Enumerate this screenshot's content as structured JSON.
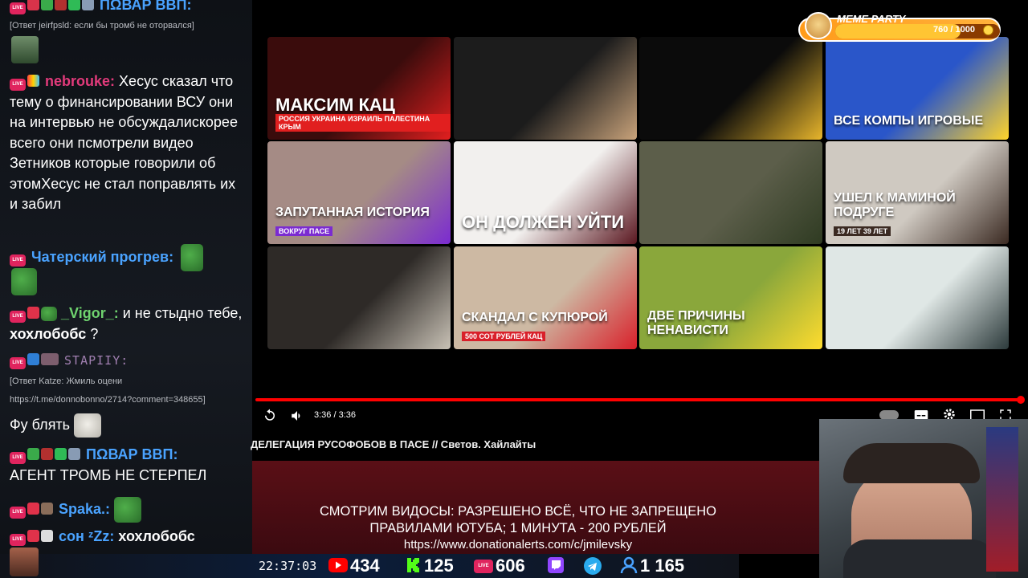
{
  "chat": {
    "top_name": "ΠΩВАР ВВΠ:",
    "messages": [
      {
        "reply": "[Ответ jeirfpsld: если бы тромб не оторвался]"
      },
      {
        "name": "nebrouke:",
        "text": "Хесус сказал что тему о финансировании ВСУ они на интервью не обсуждалискорее всего они псмотрели видео Зетников которые говорили об этомХесус не стал поправлять их и забил"
      },
      {
        "name": "Чатерский прогрев:",
        "text": ""
      },
      {
        "name": "_Vigor_:",
        "text": "и не стыдно тебе,",
        "bold_tail": "хохлобобс",
        "tail_suffix": " ?"
      },
      {
        "name": "STAPIIY:",
        "text": ""
      },
      {
        "reply": "[Ответ Katze: Жмиль оцени"
      },
      {
        "link": "https://t.me/donnobonno/2714?comment=348655]"
      },
      {
        "text": "Фу блять"
      },
      {
        "name": "ΠΩВАР ВВΠ:",
        "text": "АГЕНТ ТРОМБ НЕ СТЕРПЕЛ"
      },
      {
        "name": "Spaka.:",
        "text": ""
      },
      {
        "name": "сон ᶻZz:",
        "text": "хохлобобс"
      }
    ]
  },
  "thumbnails": [
    {
      "caption": "МАКСИМ КАЦ",
      "sub": "РОССИЯ УКРАИНА ИЗРАИЛЬ ПАЛЕСТИНА КРЫМ",
      "bg": "#3a0c0c",
      "accent": "#e11f1f"
    },
    {
      "caption": "",
      "sub": "",
      "bg": "#1c1c1c",
      "accent": "#c8a27a"
    },
    {
      "caption": "",
      "sub": "",
      "bg": "#0b0b0b",
      "accent": "#e7b52c"
    },
    {
      "caption": "ВСЕ КОМПЫ ИГРОВЫЕ",
      "sub": "",
      "bg": "#2a56c9",
      "accent": "#ffd42a"
    },
    {
      "caption": "ЗАПУТАННАЯ ИСТОРИЯ",
      "sub": "ВОКРУГ ПАСЕ",
      "bg": "#a58b85",
      "accent": "#7b2bd1"
    },
    {
      "caption": "ОН ДОЛЖЕН УЙТИ",
      "sub": "",
      "bg": "#f2f0ee",
      "accent": "#5a1720"
    },
    {
      "caption": "",
      "sub": "",
      "bg": "#5c5e4a",
      "accent": "#2f3b22"
    },
    {
      "caption": "ушел к МАМИНОЙ ПОДРУГЕ",
      "sub": "19 лет  39 лет",
      "bg": "#cfc9c1",
      "accent": "#3b2a22"
    },
    {
      "caption": "",
      "sub": "",
      "bg": "#2e2a27",
      "accent": "#c9c2b6"
    },
    {
      "caption": "Скандал с купюрой",
      "sub": "500  СОТ РУБЛЕЙ  КАЦ",
      "bg": "#cdb9a3",
      "accent": "#d9202a"
    },
    {
      "caption": "ДВЕ ПРИЧИНЫ НЕНАВИСТИ",
      "sub": "",
      "bg": "#8aa73b",
      "accent": "#ffdc2e"
    },
    {
      "caption": "",
      "sub": "",
      "bg": "#dfe7e5",
      "accent": "#2c3a3b"
    }
  ],
  "player": {
    "time": "3:36 / 3:36",
    "title": "ДЕЛЕГАЦИЯ РУСОФОБОВ В ПАСЕ // Светов. Хайлайты",
    "progress": 1.0
  },
  "banner": {
    "line1": "СМОТРИМ ВИДОСЫ: РАЗРЕШЕНО ВСЁ, ЧТО НЕ ЗАПРЕЩЕНО",
    "line2": "ПРАВИЛАМИ ЮТУБА; 1 МИНУТА - 200 РУБЛЕЙ",
    "url": "https://www.donationalerts.com/c/jmilevsky"
  },
  "stats": {
    "clock": "22:37:03",
    "youtube": "434",
    "kick": "125",
    "vk": "606",
    "twitch": "",
    "viewers": "1 165"
  },
  "meme_party": {
    "title": "MEME PARTY",
    "progress_text": "760 / 1000",
    "progress": 0.76
  },
  "colors": {
    "live_red": "#e0245e",
    "name_blue": "#4aa3ff",
    "progress_red": "#ff0000",
    "banner_red": "#5a0f16"
  }
}
